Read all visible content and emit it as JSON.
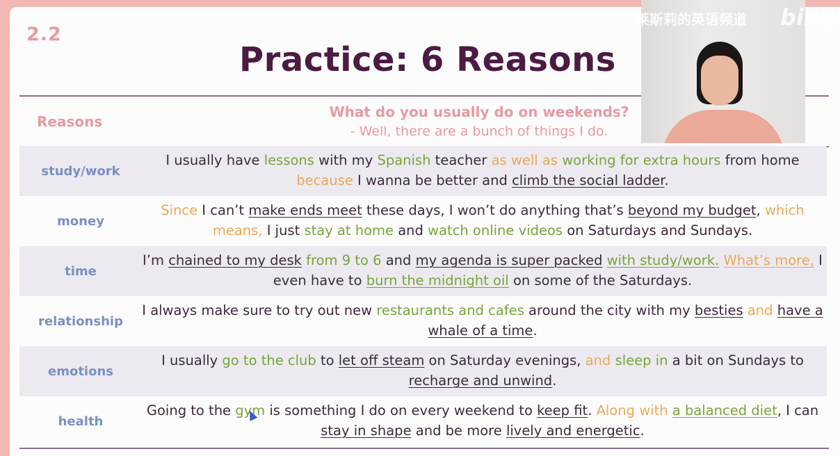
{
  "slide": {
    "number": "2.2",
    "title": "Practice: 6 Reasons"
  },
  "table": {
    "header_reasons": "Reasons",
    "header_question": "What do you usually do on weekends?",
    "header_answer": "- Well, there are a bunch of things I do."
  },
  "rows": [
    {
      "label": "study/work",
      "segments": [
        {
          "t": "I usually have ",
          "s": ""
        },
        {
          "t": "lessons",
          "s": "g"
        },
        {
          "t": " with my ",
          "s": ""
        },
        {
          "t": "Spanish",
          "s": "g"
        },
        {
          "t": " teacher ",
          "s": ""
        },
        {
          "t": "as well as",
          "s": "o"
        },
        {
          "t": " ",
          "s": ""
        },
        {
          "t": "working for extra hours",
          "s": "g"
        },
        {
          "t": " from home ",
          "s": ""
        },
        {
          "t": "because",
          "s": "o"
        },
        {
          "t": " I wanna be better and ",
          "s": ""
        },
        {
          "t": "climb the social ladder",
          "s": "u"
        },
        {
          "t": ".",
          "s": ""
        }
      ]
    },
    {
      "label": "money",
      "segments": [
        {
          "t": "Since",
          "s": "o"
        },
        {
          "t": " I can’t ",
          "s": ""
        },
        {
          "t": "make ends meet",
          "s": "u"
        },
        {
          "t": " these days, I won’t do anything that’s ",
          "s": ""
        },
        {
          "t": "beyond my budget",
          "s": "u"
        },
        {
          "t": ", ",
          "s": ""
        },
        {
          "t": "which means,",
          "s": "o"
        },
        {
          "t": " I just ",
          "s": ""
        },
        {
          "t": "stay at home",
          "s": "g"
        },
        {
          "t": " and ",
          "s": ""
        },
        {
          "t": "watch online videos",
          "s": "g"
        },
        {
          "t": " on Saturdays and Sundays.",
          "s": ""
        }
      ]
    },
    {
      "label": "time",
      "segments": [
        {
          "t": "I’m ",
          "s": ""
        },
        {
          "t": "chained to my desk",
          "s": "u"
        },
        {
          "t": " ",
          "s": ""
        },
        {
          "t": "from 9 to 6",
          "s": "g"
        },
        {
          "t": " and ",
          "s": ""
        },
        {
          "t": "my agenda is super packed",
          "s": "u"
        },
        {
          "t": " ",
          "s": ""
        },
        {
          "t": "with study/work.",
          "s": "gu"
        },
        {
          "t": " ",
          "s": ""
        },
        {
          "t": "What’s more,",
          "s": "ou"
        },
        {
          "t": " I even have to ",
          "s": ""
        },
        {
          "t": "burn the midnight oil",
          "s": "gu"
        },
        {
          "t": " on some of the Saturdays.",
          "s": ""
        }
      ]
    },
    {
      "label": "relationship",
      "segments": [
        {
          "t": "I always make sure to try out new ",
          "s": ""
        },
        {
          "t": "restaurants and cafes",
          "s": "g"
        },
        {
          "t": " around the city with my ",
          "s": ""
        },
        {
          "t": "besties",
          "s": "u"
        },
        {
          "t": " ",
          "s": ""
        },
        {
          "t": "and",
          "s": "o"
        },
        {
          "t": " ",
          "s": ""
        },
        {
          "t": "have a whale of a time",
          "s": "u"
        },
        {
          "t": ".",
          "s": ""
        }
      ]
    },
    {
      "label": "emotions",
      "segments": [
        {
          "t": "I usually ",
          "s": ""
        },
        {
          "t": "go to the club",
          "s": "g"
        },
        {
          "t": " to ",
          "s": ""
        },
        {
          "t": "let off steam",
          "s": "u"
        },
        {
          "t": " on Saturday evenings, ",
          "s": ""
        },
        {
          "t": "and",
          "s": "o"
        },
        {
          "t": " ",
          "s": ""
        },
        {
          "t": "sleep in",
          "s": "g"
        },
        {
          "t": " a bit on Sundays to ",
          "s": ""
        },
        {
          "t": "recharge and unwind",
          "s": "u"
        },
        {
          "t": ".",
          "s": ""
        }
      ]
    },
    {
      "label": "health",
      "segments": [
        {
          "t": "Going to the ",
          "s": ""
        },
        {
          "t": "gym",
          "s": "g"
        },
        {
          "t": " is something I do on every weekend to ",
          "s": ""
        },
        {
          "t": "keep fit",
          "s": "u"
        },
        {
          "t": ". ",
          "s": ""
        },
        {
          "t": "Along with",
          "s": "o"
        },
        {
          "t": " ",
          "s": ""
        },
        {
          "t": "a balanced diet",
          "s": "gu"
        },
        {
          "t": ", I can ",
          "s": ""
        },
        {
          "t": "stay in shape",
          "s": "u"
        },
        {
          "t": " and be more ",
          "s": ""
        },
        {
          "t": "lively and energetic",
          "s": "u"
        },
        {
          "t": ".",
          "s": ""
        }
      ]
    }
  ],
  "overlay": {
    "watermark": "莱斯莉的英语频道",
    "platform_logo": "bilibili"
  },
  "colors": {
    "title": "#4b1b43",
    "accent_pink": "#e79aa2",
    "label_blue": "#7a90c2",
    "green": "#7aa33a",
    "orange": "#e8a85a"
  }
}
